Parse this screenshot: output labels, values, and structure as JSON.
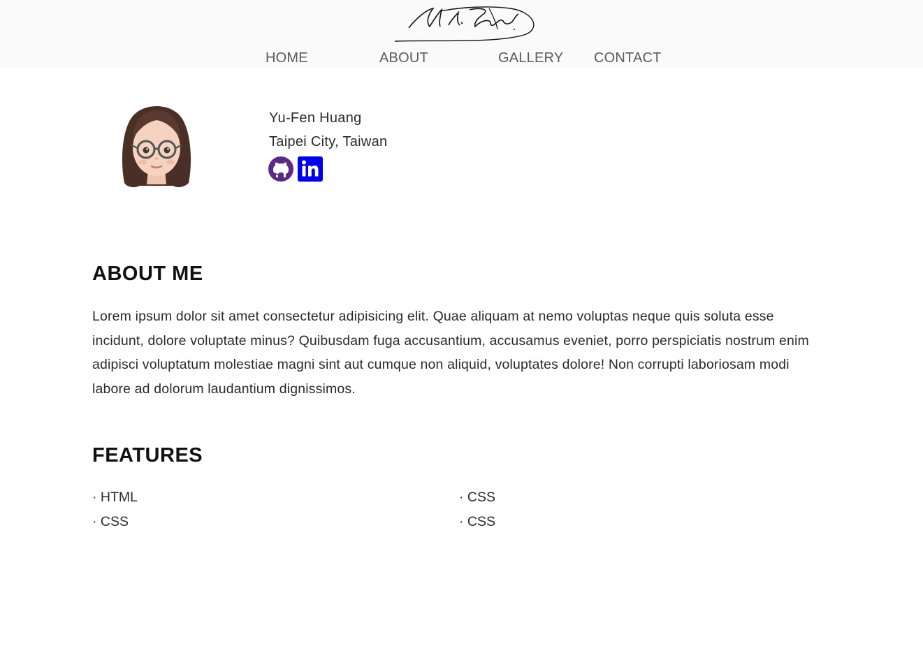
{
  "header": {
    "logo_icon": "signature-logo",
    "nav": [
      {
        "label": "HOME"
      },
      {
        "label": "ABOUT"
      },
      {
        "label": "GALLERY"
      },
      {
        "label": "CONTACT"
      }
    ]
  },
  "profile": {
    "avatar_icon": "memoji-avatar",
    "name": "Yu-Fen Huang",
    "location": "Taipei City, Taiwan",
    "social": [
      {
        "icon": "github-icon",
        "color": "#5b2a86"
      },
      {
        "icon": "linkedin-icon",
        "color": "#0000ee"
      }
    ]
  },
  "about": {
    "title": "ABOUT ME",
    "text": "Lorem ipsum dolor sit amet consectetur adipisicing elit. Quae aliquam at nemo voluptas neque quis soluta esse incidunt, dolore voluptate minus? Quibusdam fuga accusantium, accusamus eveniet, porro perspiciatis nostrum enim adipisci voluptatum molestiae magni sint aut cumque non aliquid, voluptates dolore! Non corrupti laboriosam modi labore ad dolorum laudantium dignissimos."
  },
  "features": {
    "title": "FEATURES",
    "items": [
      "· HTML",
      "· CSS",
      "· CSS",
      "· CSS"
    ]
  },
  "colors": {
    "header_bg": "#fafafa",
    "nav_text": "#5a5a5a",
    "heading": "#111111",
    "body_text": "#2a2a2a"
  }
}
